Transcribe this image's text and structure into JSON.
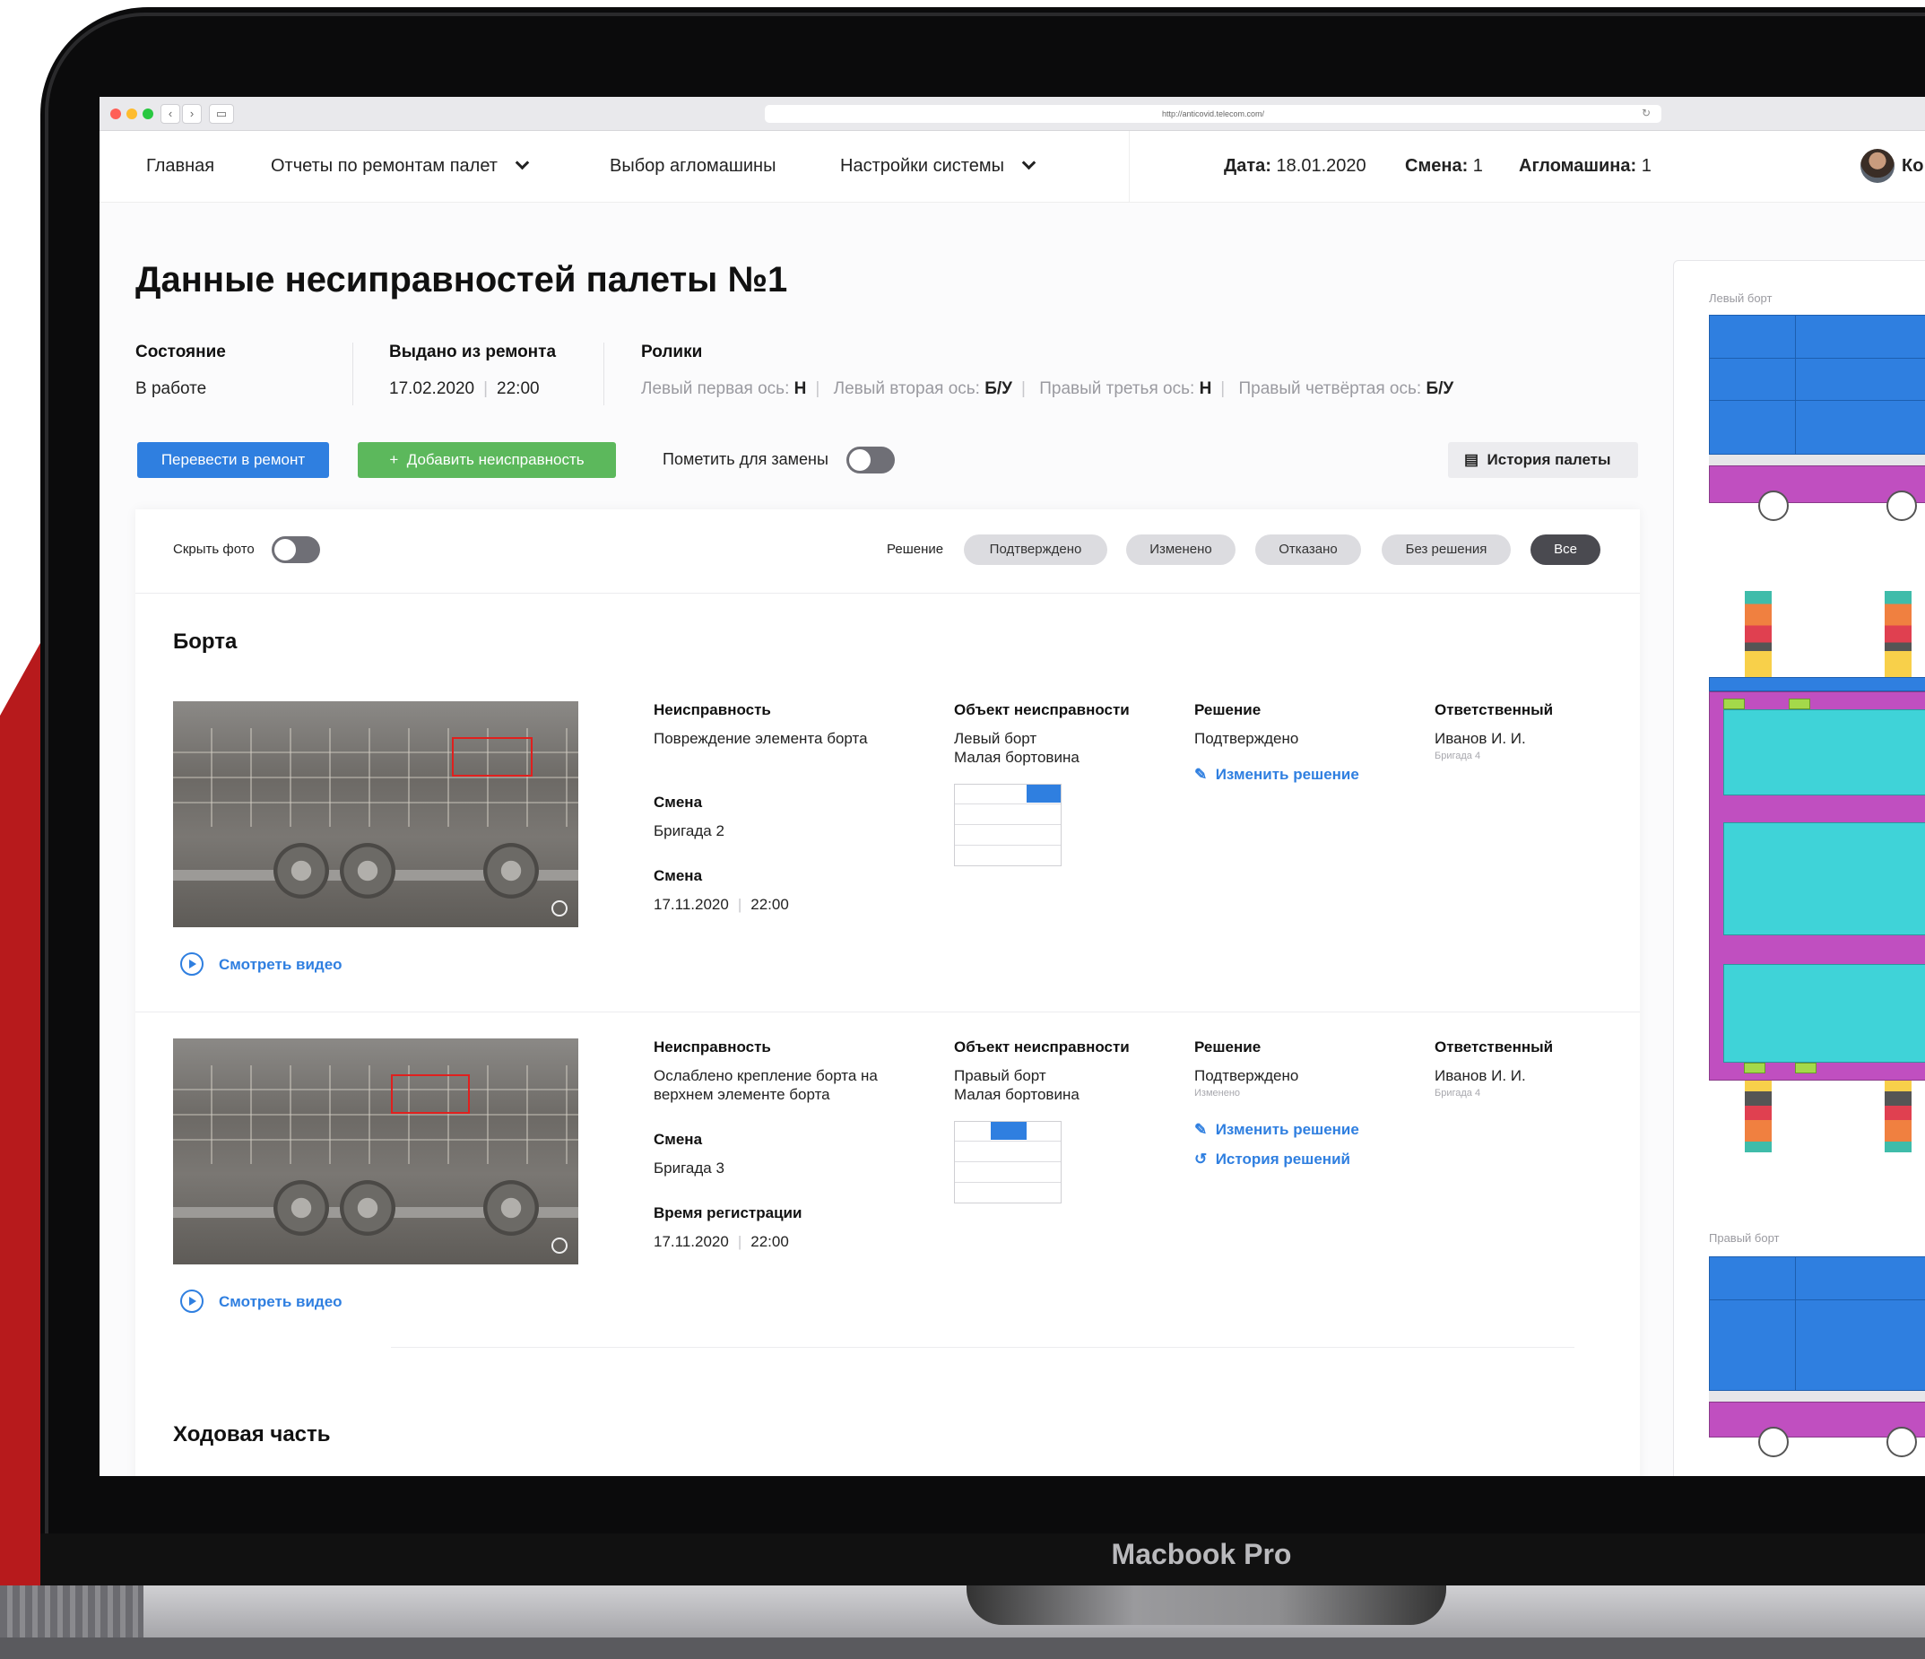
{
  "device_label": "Macbook Pro",
  "browser": {
    "url": "http://anticovid.telecom.com/"
  },
  "nav": {
    "home": "Главная",
    "reports": "Отчеты по ремонтам палет",
    "machine_select": "Выбор агломашины",
    "settings": "Настройки системы",
    "date_label": "Дата:",
    "date_value": "18.01.2020",
    "shift_label": "Смена:",
    "shift_value": "1",
    "machine_label": "Агломашина:",
    "machine_value": "1",
    "user_partial": "Ко"
  },
  "page": {
    "title": "Данные несиправностей палеты №1",
    "state_label": "Состояние",
    "state_value": "В работе",
    "issued_label": "Выдано из ремонта",
    "issued_date": "17.02.2020",
    "issued_time": "22:00",
    "rollers_label": "Ролики",
    "rollers": [
      {
        "label": "Левый первая ось:",
        "value": "Н"
      },
      {
        "label": "Левый вторая ось:",
        "value": "Б/У"
      },
      {
        "label": "Правый третья ось:",
        "value": "Н"
      },
      {
        "label": "Правый четвёртая ось:",
        "value": "Б/У"
      }
    ],
    "to_repair_button": "Перевести в ремонт",
    "add_fault_button": "Добавить неисправность",
    "mark_replace_label": "Пометить для замены",
    "history_button": "История палеты"
  },
  "filters": {
    "hide_photo_label": "Скрыть фото",
    "decision_label": "Решение",
    "options": [
      "Подтверждено",
      "Изменено",
      "Отказано",
      "Без решения",
      "Все"
    ],
    "selected": "Все"
  },
  "sections": {
    "sides": "Борта",
    "chassis": "Ходовая часть"
  },
  "faults": [
    {
      "fault_label": "Неисправность",
      "fault_value": "Повреждение элемента борта",
      "shift_label": "Смена",
      "shift_value": "Бригада 2",
      "time_label": "Смена",
      "date": "17.11.2020",
      "time": "22:00",
      "object_label": "Объект неисправности",
      "object_line1": "Левый борт",
      "object_line2": "Малая бортовина",
      "decision_label": "Решение",
      "decision_value": "Подтверждено",
      "decision_note": "",
      "change_link": "Изменить решение",
      "history_link": "",
      "responsible_label": "Ответственный",
      "responsible_name": "Иванов И. И.",
      "responsible_team": "Бригада 4",
      "video_link": "Смотреть видео"
    },
    {
      "fault_label": "Неисправность",
      "fault_value": "Ослаблено крепление борта на верхнем элементе борта",
      "shift_label": "Смена",
      "shift_value": "Бригада 3",
      "time_label": "Время регистрации",
      "date": "17.11.2020",
      "time": "22:00",
      "object_label": "Объект неисправности",
      "object_line1": "Правый борт",
      "object_line2": "Малая бортовина",
      "decision_label": "Решение",
      "decision_value": "Подтверждено",
      "decision_note": "Изменено",
      "change_link": "Изменить решение",
      "history_link": "История решений",
      "responsible_label": "Ответственный",
      "responsible_name": "Иванов И. И.",
      "responsible_team": "Бригада 4",
      "video_link": "Смотреть видео"
    }
  ],
  "diagram": {
    "left_side_label": "Левый борт",
    "right_side_label": "Правый борт"
  },
  "colors": {
    "primary_blue": "#2f7fe0",
    "success_green": "#5cb85c",
    "brand_red": "#b71a1c"
  }
}
